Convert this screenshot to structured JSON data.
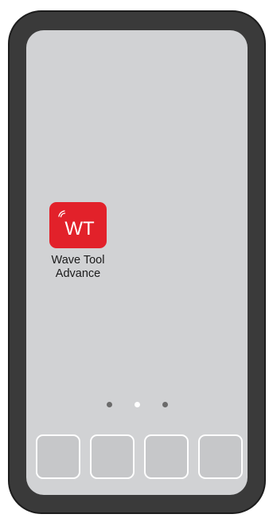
{
  "home_screen": {
    "apps": [
      {
        "label": "Wave Tool Advance",
        "label_lines": [
          "Wave Tool",
          "Advance"
        ],
        "icon": "wt-logo-icon",
        "icon_color": "#e2212a",
        "icon_text": "WT"
      }
    ],
    "page_indicator": {
      "total": 3,
      "active_index": 1
    },
    "dock": {
      "slots": 4
    }
  },
  "colors": {
    "frame": "#3a3a3a",
    "screen": "#d1d2d4",
    "accent": "#e2212a"
  }
}
